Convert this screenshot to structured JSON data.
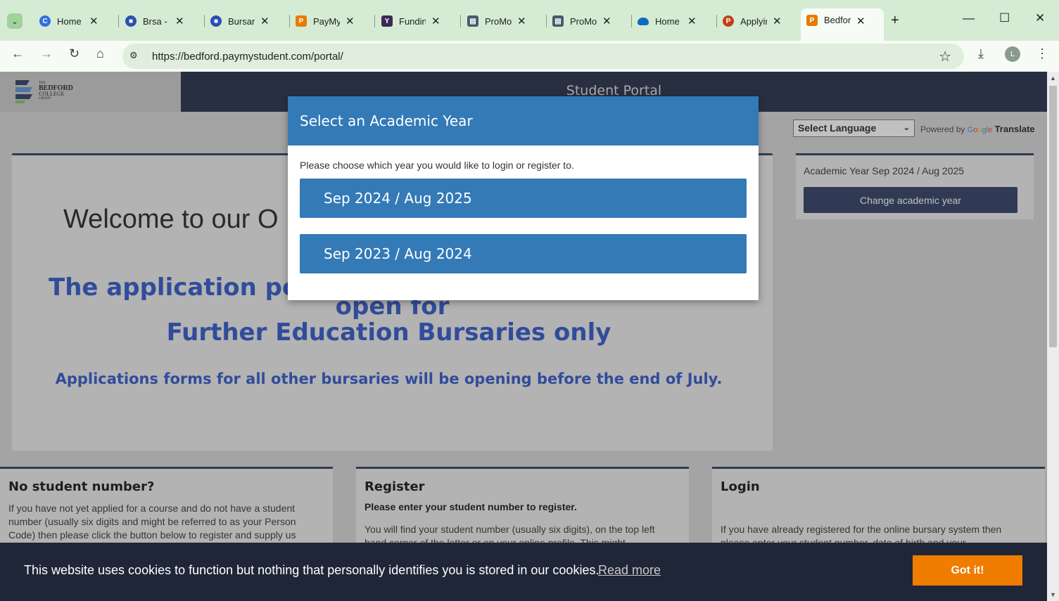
{
  "browser": {
    "tabs": [
      {
        "title": "Home",
        "icon": "copilot-icon",
        "color": "#2f6fde"
      },
      {
        "title": "Brsa - F",
        "icon": "printer-icon",
        "color": "#2a4fb5"
      },
      {
        "title": "Bursary",
        "icon": "printer-icon",
        "color": "#2a4fb5"
      },
      {
        "title": "PayMy",
        "icon": "paymystudent-icon",
        "color": "#e87a00"
      },
      {
        "title": "Fundin",
        "icon": "funding-icon",
        "color": "#3a2a55"
      },
      {
        "title": "ProMo",
        "icon": "promonitor-icon",
        "color": "#4a5a6a"
      },
      {
        "title": "ProMo",
        "icon": "promonitor-icon",
        "color": "#4a5a6a"
      },
      {
        "title": "Home",
        "icon": "onedrive-icon",
        "color": "#0f6cbd"
      },
      {
        "title": "Applyir",
        "icon": "powerpoint-icon",
        "color": "#c43e1c"
      },
      {
        "title": "Bedfor",
        "icon": "paymystudent-icon",
        "color": "#e87a00"
      }
    ],
    "url": "https://bedford.paymystudent.com/portal/",
    "avatar_initial": "L"
  },
  "site": {
    "logo_lines": [
      "THE",
      "BEDFORD",
      "COLLEGE",
      "GROUP"
    ],
    "banner_title": "Student Portal",
    "language_select": "Select Language",
    "powered_by": "Powered by",
    "google": "Google",
    "translate": "Translate"
  },
  "main": {
    "welcome": "Welcome to our O",
    "notice_line1": "The application por",
    "notice_line2": "open for",
    "notice_line3": "Further Education Bursaries only",
    "notice_line4": "Applications forms for all other bursaries will be opening before the end of July."
  },
  "year_card": {
    "label": "Academic Year Sep 2024 / Aug 2025",
    "button": "Change academic year"
  },
  "columns": {
    "no_student": {
      "title": "No student number?",
      "text": "If you have not yet applied for a course and do not have a student number (usually six digits and might be referred to as your Person Code) then please click the button below to register and supply us"
    },
    "register": {
      "title": "Register",
      "subtitle": "Please enter your student number to register.",
      "text": "You will find your student number (usually six digits), on the top left hand corner of the letter or on your online profile. This might"
    },
    "login": {
      "title": "Login",
      "text": "If you have already registered for the online bursary system then please enter your student number, date of birth and your"
    }
  },
  "modal": {
    "title": "Select an Academic Year",
    "prompt": "Please choose which year you would like to login or register to.",
    "years": [
      "Sep 2024 / Aug 2025",
      "Sep 2023 / Aug 2024"
    ]
  },
  "cookie": {
    "text": "This website uses cookies to function but nothing that personally identifies you is stored in our cookies.",
    "link": "Read more",
    "button": "Got it!"
  }
}
